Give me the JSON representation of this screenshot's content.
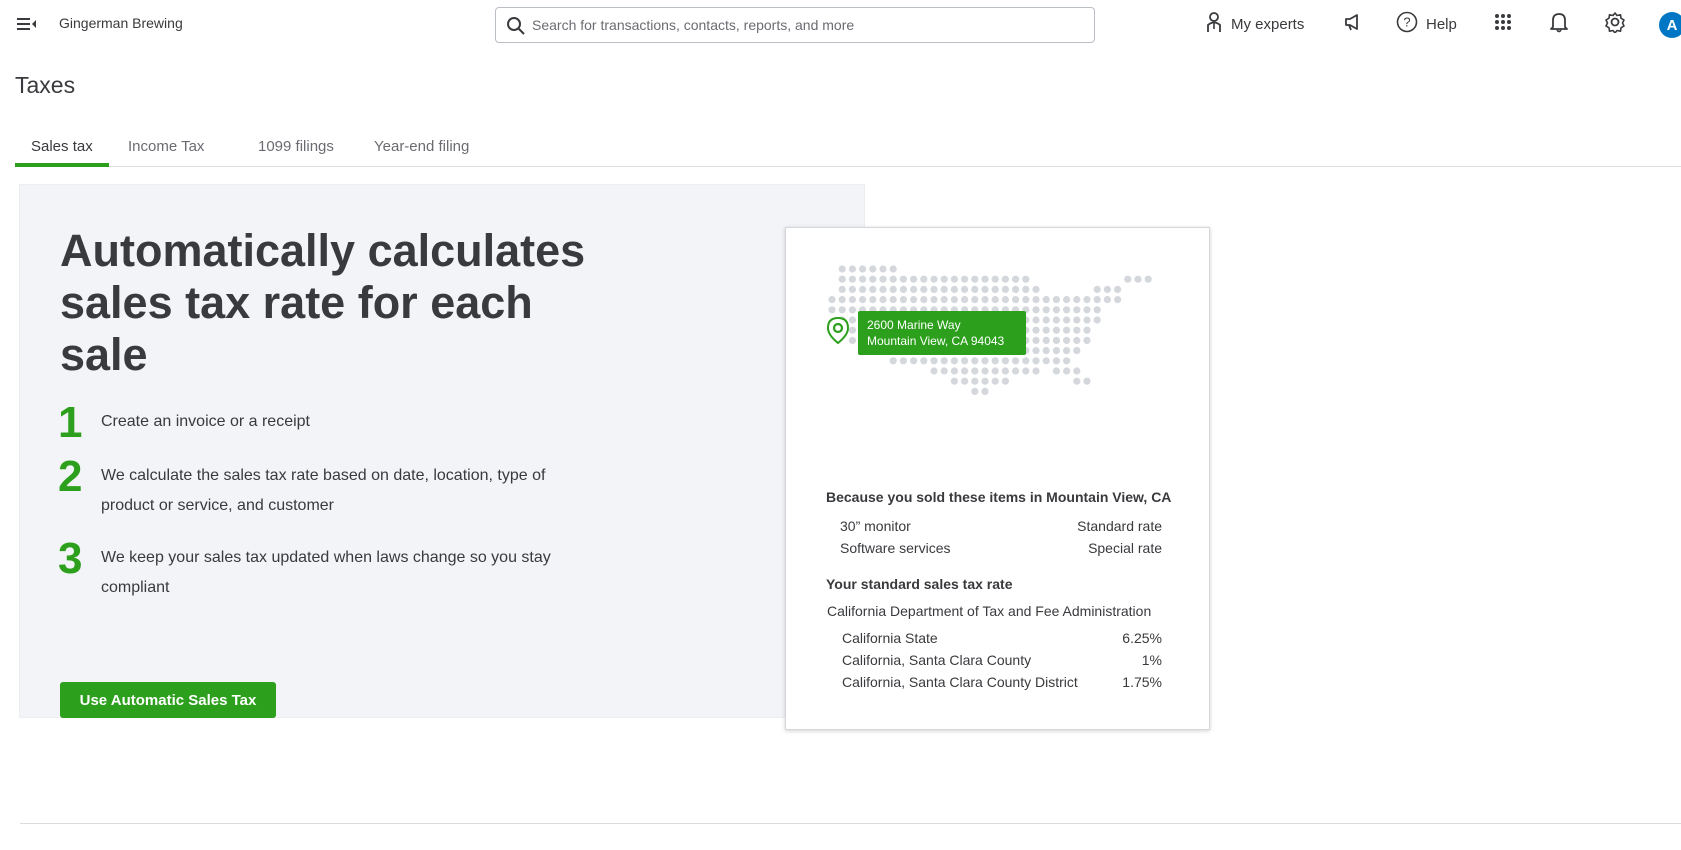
{
  "header": {
    "company_name": "Gingerman Brewing",
    "search_placeholder": "Search for transactions, contacts, reports, and more",
    "my_experts_label": "My experts",
    "help_label": "Help",
    "avatar_initial": "A",
    "icons": [
      "menu-icon",
      "search-icon",
      "experts-icon",
      "megaphone-icon",
      "help-icon",
      "apps-grid-icon",
      "bell-icon",
      "gear-icon"
    ]
  },
  "page": {
    "title": "Taxes",
    "tabs": [
      {
        "label": "Sales tax",
        "active": true
      },
      {
        "label": "Income Tax",
        "active": false
      },
      {
        "label": "1099 filings",
        "active": false
      },
      {
        "label": "Year-end filing",
        "active": false
      }
    ]
  },
  "promo": {
    "headline": "Automatically calculates sales tax rate for each sale",
    "steps": [
      {
        "num": "1",
        "text": "Create an invoice or a receipt"
      },
      {
        "num": "2",
        "text": "We calculate the sales tax rate based on date, location, type of product or service, and customer"
      },
      {
        "num": "3",
        "text": "We keep your sales tax updated when laws change so you stay compliant"
      }
    ],
    "cta_label": "Use Automatic Sales Tax"
  },
  "card": {
    "address_line1": "2600 Marine Way",
    "address_line2": "Mountain View, CA 94043",
    "sold_heading": "Because you sold these items in Mountain View, CA",
    "items": [
      {
        "name": "30” monitor",
        "rate": "Standard rate"
      },
      {
        "name": "Software services",
        "rate": "Special rate"
      }
    ],
    "standard_heading": "Your standard sales tax rate",
    "agency": "California Department of Tax and Fee Administration",
    "rates": [
      {
        "name": "California State",
        "value": "6.25%"
      },
      {
        "name": "California, Santa Clara County",
        "value": "1%"
      },
      {
        "name": "California, Santa Clara County District",
        "value": "1.75%"
      }
    ]
  },
  "colors": {
    "brand_green": "#2ca01c",
    "avatar_blue": "#0077c5",
    "panel_bg": "#f3f4f7",
    "map_dot": "#d4d7dc"
  }
}
